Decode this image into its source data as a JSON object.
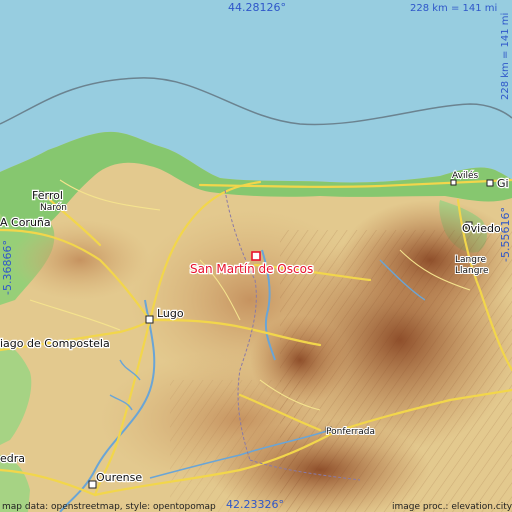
{
  "map": {
    "target_place": "San Martín de Oscos",
    "coords": {
      "top": "44.28126°",
      "bottom": "42.23326°",
      "left": "-5.36866°",
      "right": "-5.55616°"
    },
    "scale_top": "228 km = 141 mi",
    "scale_right": "228 km = 141 mi",
    "places": {
      "ferrol": "Ferrol",
      "naron": "Narón",
      "coruna": "A Coruña",
      "santiago": "iago de Compostela",
      "lugo": "Lugo",
      "ourense": "Ourense",
      "pedra": "edra",
      "ponferrada": "Ponferrada",
      "aviles": "Avilés",
      "gijon": "Gi",
      "oviedo": "Oviedo",
      "langre": "Langre",
      "llangre": "Llangre"
    },
    "attribution_left": "map data: openstreetmap, style: opentopomap",
    "attribution_right": "image proc.: elevation.city"
  },
  "colors": {
    "sea": "#97cde0",
    "coast_lowland": "#7fc96c",
    "plateau": "#e6cc91",
    "hills": "#cfa066",
    "mountains": "#a9663a",
    "roads": "#f2d64b",
    "target": "#e8122d",
    "coord_text": "#2f57c9"
  }
}
